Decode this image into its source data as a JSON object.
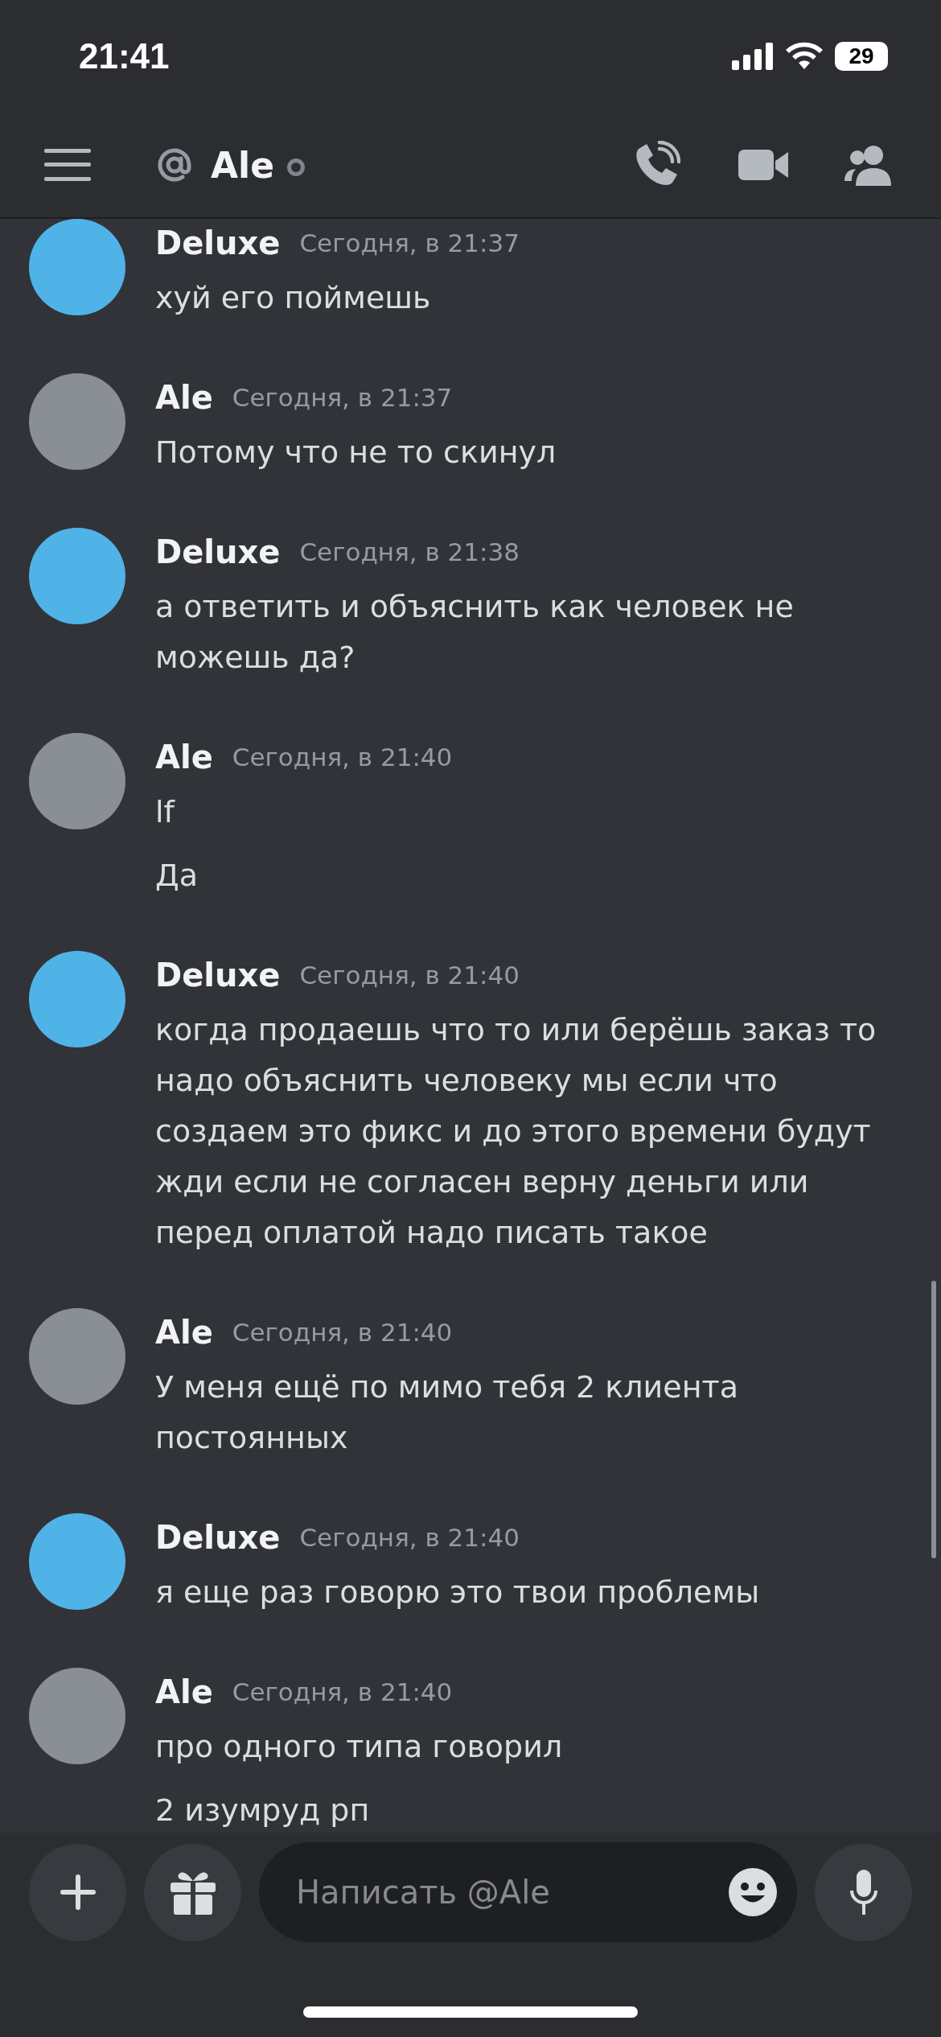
{
  "status_bar": {
    "time": "21:41",
    "battery": "29"
  },
  "header": {
    "title": "Ale",
    "online": false
  },
  "messages": [
    {
      "author": "Deluxe",
      "time": "Сегодня, в 21:37",
      "color": "#4fb3e8",
      "lines": [
        "хуй его поймешь"
      ]
    },
    {
      "author": "Ale",
      "time": "Сегодня, в 21:37",
      "color": "#8a8f96",
      "lines": [
        "Потому что не то скинул"
      ]
    },
    {
      "author": "Deluxe",
      "time": "Сегодня, в 21:38",
      "color": "#4fb3e8",
      "lines": [
        "а ответить и объяснить как человек не можешь да?"
      ]
    },
    {
      "author": "Ale",
      "time": "Сегодня, в 21:40",
      "color": "#8a8f96",
      "lines": [
        "lf",
        "Да"
      ]
    },
    {
      "author": "Deluxe",
      "time": "Сегодня, в 21:40",
      "color": "#4fb3e8",
      "lines": [
        "когда продаешь что то или берёшь заказ то надо объяснить человеку мы если что создаем это фикс и до этого времени будут жди если не согласен верну деньги или перед оплатой надо писать такое"
      ]
    },
    {
      "author": "Ale",
      "time": "Сегодня, в 21:40",
      "color": "#8a8f96",
      "lines": [
        "У меня ещё по мимо тебя 2 клиента постоянных"
      ]
    },
    {
      "author": "Deluxe",
      "time": "Сегодня, в 21:40",
      "color": "#4fb3e8",
      "lines": [
        "я еще раз говорю это твои проблемы"
      ]
    },
    {
      "author": "Ale",
      "time": "Сегодня, в 21:40",
      "color": "#8a8f96",
      "lines": [
        "про одного типа говорил",
        "2 изумруд рп"
      ]
    }
  ],
  "composer": {
    "placeholder": "Написать @Ale"
  }
}
